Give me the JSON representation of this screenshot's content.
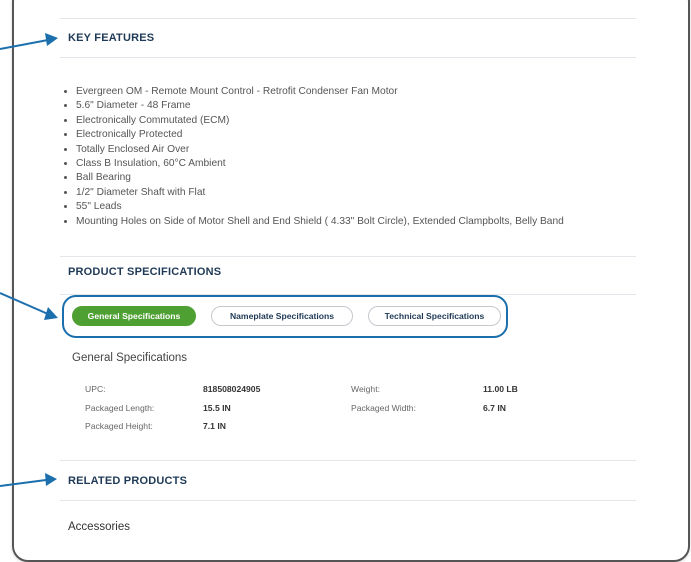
{
  "sections": {
    "key_features": {
      "title": "KEY FEATURES",
      "items": [
        "Evergreen OM - Remote Mount Control - Retrofit Condenser Fan Motor",
        "5.6\" Diameter - 48 Frame",
        "Electronically Commutated (ECM)",
        "Electronically Protected",
        "Totally Enclosed Air Over",
        "Class B Insulation, 60°C Ambient",
        "Ball Bearing",
        "1/2\" Diameter Shaft with Flat",
        "55\" Leads",
        "Mounting Holes on Side of Motor Shell and End Shield ( 4.33\" Bolt Circle), Extended Clampbolts, Belly Band"
      ]
    },
    "product_specifications": {
      "title": "PRODUCT SPECIFICATIONS",
      "tabs": [
        {
          "label": "General Specifications",
          "active": true
        },
        {
          "label": "Nameplate Specifications",
          "active": false
        },
        {
          "label": "Technical Specifications",
          "active": false
        }
      ],
      "general": {
        "title": "General Specifications",
        "rows": [
          {
            "label": "UPC:",
            "value": "818508024905",
            "label2": "Weight:",
            "value2": "11.00 LB"
          },
          {
            "label": "Packaged Length:",
            "value": "15.5 IN",
            "label2": "Packaged Width:",
            "value2": "6.7 IN"
          },
          {
            "label": "Packaged Height:",
            "value": "7.1 IN"
          }
        ]
      }
    },
    "related_products": {
      "title": "RELATED PRODUCTS",
      "subtitle": "Accessories"
    }
  },
  "colors": {
    "accent_green": "#4fa033",
    "annotation_blue": "#1b6fad",
    "heading_navy": "#1f3a57"
  }
}
